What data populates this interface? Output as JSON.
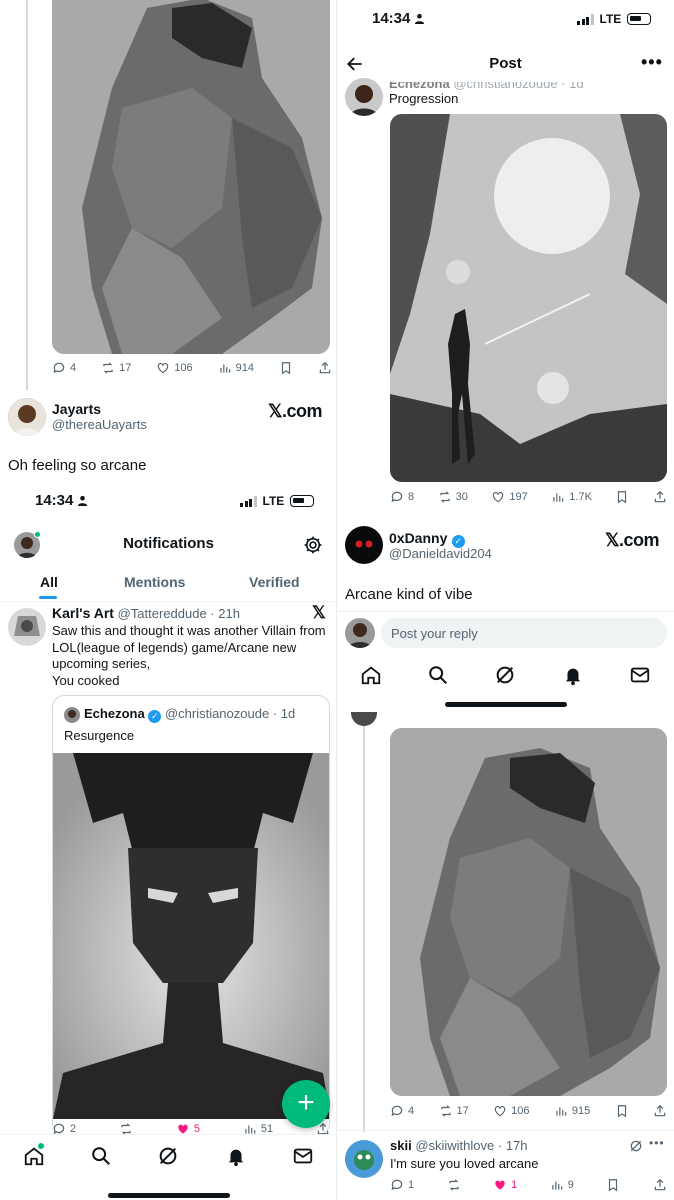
{
  "top_left": {
    "actions": {
      "replies": "4",
      "reposts": "17",
      "likes": "106",
      "views": "914"
    },
    "author": {
      "name": "Jayarts",
      "handle": "@thereaUayarts"
    },
    "brand": "𝕏.com",
    "caption": "Oh feeling so arcane"
  },
  "bottom_left": {
    "status": {
      "time": "14:34",
      "network": "LTE"
    },
    "header": {
      "title": "Notifications"
    },
    "tabs": [
      "All",
      "Mentions",
      "Verified"
    ],
    "notification": {
      "name": "Karl's Art",
      "handle": "@Tattereddude",
      "time": "· 21h",
      "text_line1": "Saw this and thought it was another Villain from",
      "text_line2": "LOL(league of legends) game/Arcane new",
      "text_line3": "upcoming series,",
      "text_line4": "You cooked"
    },
    "quote": {
      "name": "Echezona",
      "handle": "@christianozoude",
      "time": "· 1d",
      "text": "Resurgence"
    },
    "actions": {
      "replies": "2",
      "likes": "5",
      "views": "51"
    },
    "fab": "+"
  },
  "top_right": {
    "status": {
      "time": "14:34",
      "network": "LTE"
    },
    "header": {
      "title": "Post"
    },
    "partial_author": {
      "name": "Echezona",
      "handle": "@christianozoude · 1d"
    },
    "post_text": "Progression",
    "actions": {
      "replies": "8",
      "reposts": "30",
      "likes": "197",
      "views": "1.7K"
    },
    "author": {
      "name": "0xDanny",
      "handle": "@Danieldavid204"
    },
    "brand": "𝕏.com",
    "caption": "Arcane kind of vibe",
    "reply_placeholder": "Post your reply"
  },
  "bottom_right": {
    "actions": {
      "replies": "4",
      "reposts": "17",
      "likes": "106",
      "views": "915"
    },
    "reply": {
      "name": "skii",
      "handle": "@skiiwithlove",
      "time": "· 17h",
      "text": "I'm sure you loved arcane"
    },
    "reply_actions": {
      "replies": "1",
      "likes": "1",
      "views": "9"
    }
  },
  "colors": {
    "accent": "#1d9bf0",
    "like": "#f91880",
    "fab": "#00ba7c",
    "text_secondary": "#536471"
  }
}
